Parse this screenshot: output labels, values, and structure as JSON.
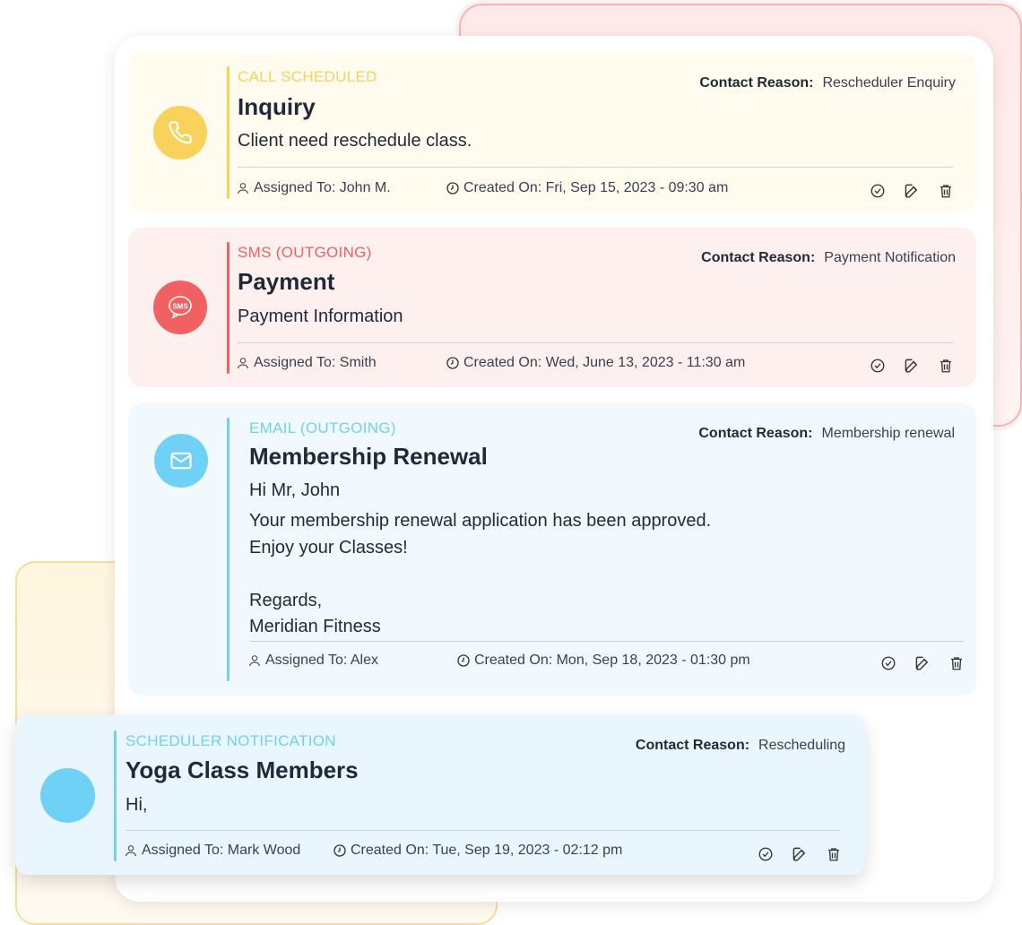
{
  "colors": {
    "call": "#f9d25c",
    "sms": "#f16162",
    "email": "#6fd1f6",
    "scheduler": "#6fd1f6"
  },
  "cards": [
    {
      "type": "CALL SCHEDULED",
      "icon": "phone-icon",
      "title": "Inquiry",
      "body": [
        "Client need reschedule class."
      ],
      "contact_reason_label": "Contact Reason:",
      "contact_reason": "Rescheduler Enquiry",
      "assigned": "Assigned To: John M.",
      "created": "Created On: Fri, Sep 15, 2023 - 09:30 am"
    },
    {
      "type": "SMS (OUTGOING)",
      "icon": "sms-bubble-icon",
      "icon_text": "SMS",
      "title": "Payment",
      "body": [
        "Payment Information"
      ],
      "contact_reason_label": "Contact Reason:",
      "contact_reason": "Payment Notification",
      "assigned": "Assigned To: Smith",
      "created": "Created On: Wed, June 13, 2023 - 11:30 am"
    },
    {
      "type": "EMAIL (OUTGOING)",
      "icon": "envelope-icon",
      "title": "Membership Renewal",
      "body": [
        "Hi Mr, John",
        "Your membership renewal application has been approved.",
        "Enjoy your Classes!",
        "",
        "Regards,",
        "Meridian Fitness"
      ],
      "contact_reason_label": "Contact Reason:",
      "contact_reason": "Membership renewal",
      "assigned": "Assigned To: Alex",
      "created": "Created On: Mon, Sep 18, 2023 - 01:30 pm"
    },
    {
      "type": "SCHEDULER NOTIFICATION",
      "icon": "none",
      "title": "Yoga Class Members",
      "body": [
        "Hi,"
      ],
      "contact_reason_label": "Contact Reason:",
      "contact_reason": "Rescheduling",
      "assigned": "Assigned To: Mark Wood",
      "created": "Created On: Tue, Sep 19, 2023 - 02:12 pm"
    }
  ]
}
